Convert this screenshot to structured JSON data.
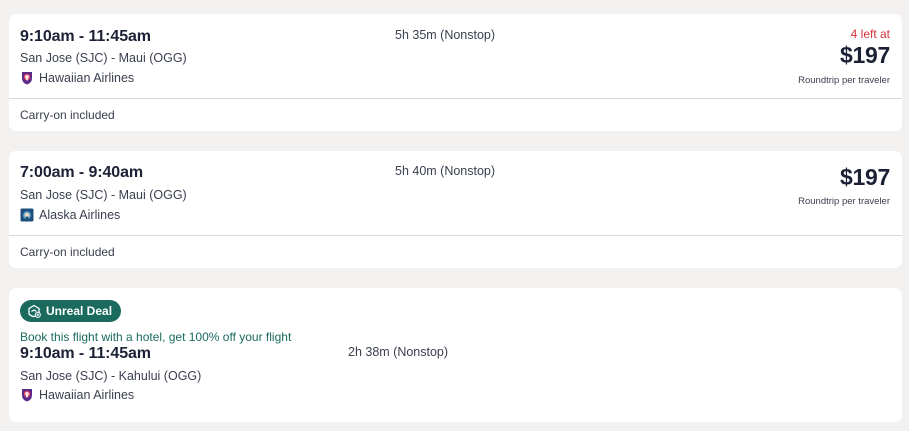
{
  "flights": [
    {
      "times": "9:10am - 11:45am",
      "route": "San Jose (SJC) - Maui (OGG)",
      "airline": "Hawaiian Airlines",
      "airline_logo": "hawaiian-airlines-logo",
      "duration": "5h 35m (Nonstop)",
      "urgency": "4 left at",
      "price": "$197",
      "price_note": "Roundtrip per traveler",
      "amenity": "Carry-on included"
    },
    {
      "times": "7:00am - 9:40am",
      "route": "San Jose (SJC) - Maui (OGG)",
      "airline": "Alaska Airlines",
      "airline_logo": "alaska-airlines-logo",
      "duration": "5h 40m (Nonstop)",
      "price": "$197",
      "price_note": "Roundtrip per traveler",
      "amenity": "Carry-on included"
    },
    {
      "badge": "Unreal Deal",
      "badge_icon": "hotel-plus-flight-icon",
      "deal_text": "Book this flight with a hotel, get 100% off your flight",
      "times": "9:10am - 11:45am",
      "route": "San Jose (SJC) - Kahului (OGG)",
      "airline": "Hawaiian Airlines",
      "airline_logo": "hawaiian-airlines-logo",
      "duration": "2h 38m (Nonstop)"
    }
  ],
  "colors": {
    "page_bg": "#f3f1f0",
    "card_bg": "#ffffff",
    "urgency": "#d3323a",
    "deal_green": "#1a6a5e",
    "text_dark": "#1c2236"
  }
}
